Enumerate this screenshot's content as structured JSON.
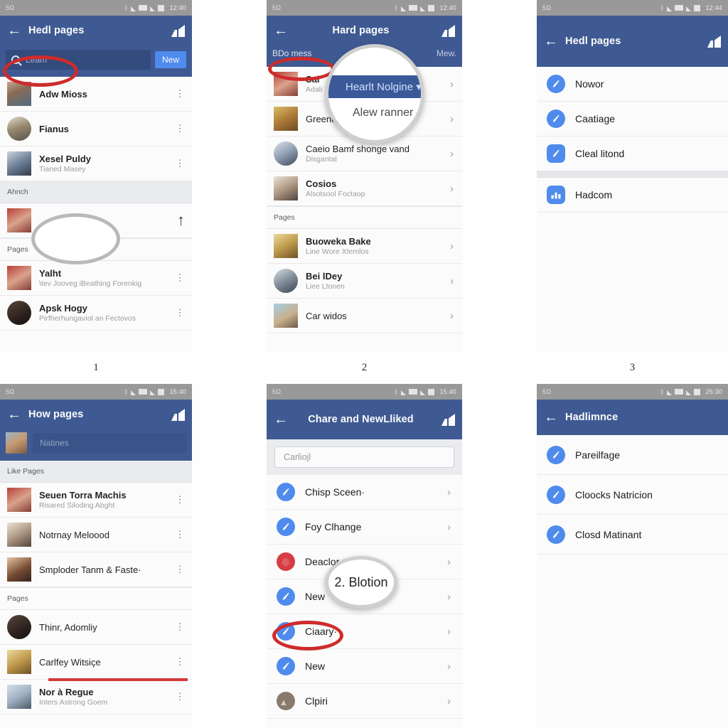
{
  "panel_numbers": [
    "1",
    "2",
    "3"
  ],
  "statusbar": {
    "left_text": "5Ω",
    "time_1": "12:40",
    "time_2": "12:40",
    "time_3": "12:44",
    "time_4": "15:40",
    "time_5": "15:40",
    "time_6": "25:30",
    "icons": [
      "bluetooth-icon",
      "signal-icon",
      "wifi-icon",
      "signal2-icon",
      "battery-icon"
    ]
  },
  "panel1": {
    "title": "Hedl pages",
    "search_placeholder": "Leam",
    "new_button": "New",
    "rows": [
      {
        "title": "Adw Mioss",
        "sub": ""
      },
      {
        "title": "Fianus",
        "sub": ""
      },
      {
        "title": "Xesel Puldy",
        "sub": "Tianed Masey"
      }
    ],
    "section_a": "Ahnch",
    "section_b": "Pages",
    "rows2": [
      {
        "title": "Yalht",
        "sub": "\\tev Jooveg iBeathing Forenkig"
      },
      {
        "title": "Apsk Hogy",
        "sub": "Pirfherhungaviol an Fectovos"
      }
    ]
  },
  "panel2": {
    "title": "Hard pages",
    "tab_left": "BDo mess",
    "tab_right": "Mew.",
    "magnifier_highlight": "Hearlt Nolgine ▾",
    "magnifier_item": "Alew ranner",
    "rows": [
      {
        "title": "Sal",
        "sub": "Adali"
      },
      {
        "title": "Greenent  Homy",
        "sub": ""
      },
      {
        "title": "Caeio Bamf shonge vand",
        "sub": "Disgantal"
      },
      {
        "title": "Cosios",
        "sub": "Alsotsool Foctaop"
      }
    ],
    "section": "Pages",
    "rows2": [
      {
        "title": "Buoweka Bake",
        "sub": "Line Wore Xtemlos"
      },
      {
        "title": "Bei lDey",
        "sub": "Liee Ltonen"
      },
      {
        "title": "Car widos",
        "sub": ""
      }
    ]
  },
  "panel3": {
    "title": "Hedl pages",
    "rows": [
      {
        "label": "Nowor",
        "icon": "pen-circle-icon"
      },
      {
        "label": "Caatiage",
        "icon": "pen-circle-icon"
      },
      {
        "label": "Cleal litond",
        "icon": "pen-square-icon"
      }
    ],
    "rows2": [
      {
        "label": "Hadcom",
        "icon": "chart-icon"
      }
    ]
  },
  "panel4": {
    "title": "How pages",
    "composer_placeholder": "Natines",
    "section_a": "Like Pages",
    "rows": [
      {
        "title": "Seuen Torra Machis",
        "sub": "Risared Siloding Abght"
      },
      {
        "title": "Notrnay Meloood",
        "sub": ""
      },
      {
        "title": "Smploder Tanm & Faste·",
        "sub": ""
      }
    ],
    "section_b": "Pages",
    "rows2": [
      {
        "title": "Thinr, Adomliy",
        "sub": ""
      },
      {
        "title": "Carlfey Witsiçe",
        "sub": ""
      },
      {
        "title": "Nor à Regue",
        "sub": "Inters Astrong Goem"
      }
    ]
  },
  "panel5": {
    "title": "Chare and NewLliked",
    "search_placeholder": "Carliojl",
    "magnifier_label": "2. Blotion",
    "rows": [
      {
        "label": "Chisp Sceen·",
        "icon": "pen-circle-icon"
      },
      {
        "label": "Foy Clhange",
        "icon": "pen-circle-icon"
      },
      {
        "label": "Deaclor",
        "icon": "apple-icon"
      },
      {
        "label": "New",
        "icon": "pen-circle-icon"
      },
      {
        "label": "Ciaary·",
        "icon": "pen-circle-icon"
      },
      {
        "label": "New",
        "icon": "pen-circle-icon"
      },
      {
        "label": "Clpiri",
        "icon": "photo-icon"
      }
    ]
  },
  "panel6": {
    "title": "Hadlimnce",
    "rows": [
      {
        "label": "Pareilfage",
        "icon": "pen-circle-icon"
      },
      {
        "label": "Cloocks Natricion",
        "icon": "pen-circle-icon"
      },
      {
        "label": "Closd Matinant",
        "icon": "pen-circle-icon"
      }
    ]
  },
  "colors": {
    "fb_blue": "#3b5998",
    "accent_blue": "#4a8cf7",
    "annotation_red": "#cf2b2b",
    "annotation_gray": "#b9b9b9",
    "statusbar_gray": "#9a9a9a",
    "section_bg": "#eceef2"
  }
}
